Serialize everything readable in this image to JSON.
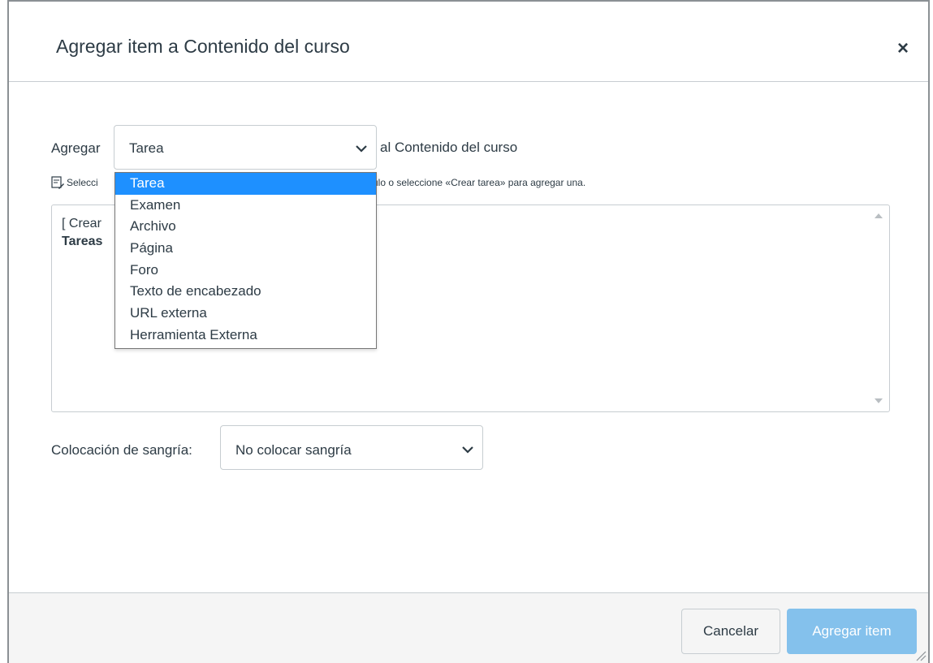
{
  "dialog": {
    "title": "Agregar item a Contenido del curso",
    "close_symbol": "×"
  },
  "add_row": {
    "label_before": "Agregar",
    "selected_type": "Tarea",
    "label_after": "al Contenido del curso"
  },
  "note": {
    "text_left": "Selecci",
    "text_right": "ulo o seleccione «Crear tarea» para agregar una.",
    "icon": "edit-note-icon"
  },
  "list": {
    "line1": "[ Crear",
    "line2": "Tareas"
  },
  "type_dropdown": {
    "options": [
      "Tarea",
      "Examen",
      "Archivo",
      "Página",
      "Foro",
      "Texto de encabezado",
      "URL externa",
      "Herramienta Externa"
    ],
    "highlighted": "Tarea",
    "highlight_color": "#1e90ff"
  },
  "indent": {
    "label": "Colocación de sangría:",
    "value": "No colocar sangría"
  },
  "footer": {
    "cancel_label": "Cancelar",
    "submit_label": "Agregar item",
    "submit_color": "#84c1ec"
  }
}
